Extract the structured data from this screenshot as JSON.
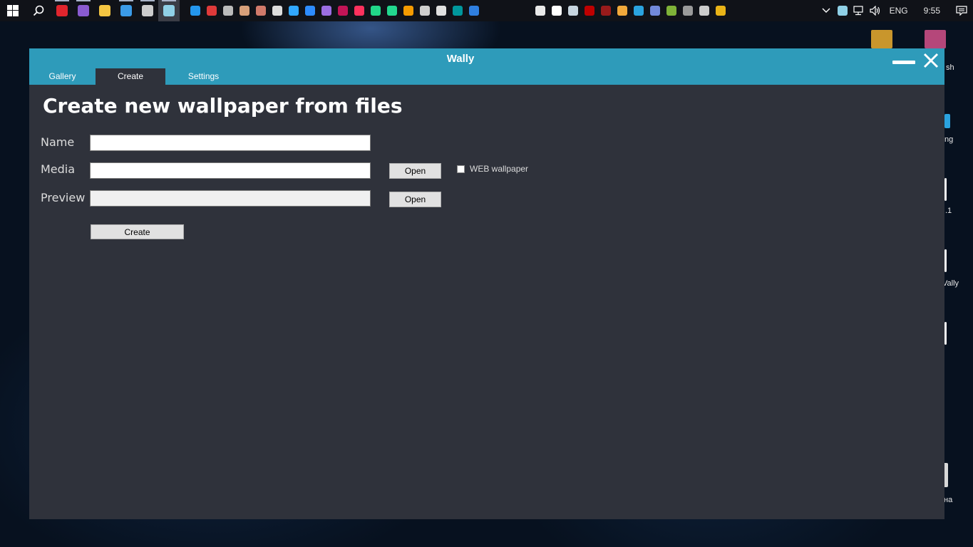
{
  "taskbar": {
    "start_icon": "windows-logo-icon",
    "search_icon": "search-icon",
    "pinned": [
      {
        "name": "opera-icon",
        "color": "#e1252d",
        "running": true
      },
      {
        "name": "visual-studio-icon",
        "color": "#8a5bd0",
        "running": true
      },
      {
        "name": "file-explorer-icon",
        "color": "#f4c542",
        "running": false
      },
      {
        "name": "internet-explorer-icon",
        "color": "#3b9be8",
        "running": true
      },
      {
        "name": "terminal-icon",
        "color": "#cccccc",
        "running": true
      },
      {
        "name": "wally-app-icon",
        "color": "#8fd0e6",
        "running": true,
        "active": true
      }
    ],
    "apps": [
      {
        "name": "docker-icon",
        "color": "#2496ed"
      },
      {
        "name": "git-icon",
        "color": "#e03a3a"
      },
      {
        "name": "clock-app-icon",
        "color": "#bbbbbb"
      },
      {
        "name": "app-icon-1",
        "color": "#d8a07a"
      },
      {
        "name": "app-icon-2",
        "color": "#d27a6a"
      },
      {
        "name": "copy-app-icon",
        "color": "#dddddd"
      },
      {
        "name": "photoshop-icon",
        "color": "#31a8ff"
      },
      {
        "name": "zoom-icon",
        "color": "#2d8cff"
      },
      {
        "name": "visual-studio-code-icon",
        "color": "#9b6ee3"
      },
      {
        "name": "rider-icon",
        "color": "#c21456"
      },
      {
        "name": "intellij-icon",
        "color": "#fe315d"
      },
      {
        "name": "pycharm-icon",
        "color": "#21d789"
      },
      {
        "name": "clion-icon",
        "color": "#22d88f"
      },
      {
        "name": "virtualbox-icon",
        "color": "#f59b00"
      },
      {
        "name": "image-viewer-icon",
        "color": "#cfcfcf"
      },
      {
        "name": "unity-icon",
        "color": "#e0e0e0"
      },
      {
        "name": "arduino-icon",
        "color": "#00979c"
      },
      {
        "name": "blue-app-icon",
        "color": "#2f7fe0"
      }
    ],
    "tray_apps": [
      {
        "name": "chrome-icon",
        "color": "#e9e9e9"
      },
      {
        "name": "wave-app-icon",
        "color": "#ffffff"
      },
      {
        "name": "steam-icon",
        "color": "#c7d5e0"
      },
      {
        "name": "filezilla-icon",
        "color": "#bf0000"
      },
      {
        "name": "vim-icon",
        "color": "#9a1b1b"
      },
      {
        "name": "chess-app-icon",
        "color": "#f2a93b"
      },
      {
        "name": "telegram-icon",
        "color": "#2aa3df"
      },
      {
        "name": "discord-icon",
        "color": "#7289da"
      },
      {
        "name": "minecraft-icon",
        "color": "#7fb238"
      },
      {
        "name": "app-icon-3",
        "color": "#9a9a9a"
      },
      {
        "name": "gear-app-icon",
        "color": "#cccccc"
      },
      {
        "name": "yellow-app-icon",
        "color": "#e9b317"
      }
    ],
    "tray": {
      "chevron_icon": "chevron-up-icon",
      "language": "ENG",
      "time": "9:55"
    }
  },
  "desktop_fragments": {
    "label_1": "sh",
    "label_2": "ng",
    "label_3": ".1",
    "label_4": "Vally",
    "label_5": "на"
  },
  "window": {
    "title": "Wally",
    "tabs": [
      {
        "label": "Gallery",
        "active": false
      },
      {
        "label": "Create",
        "active": true
      },
      {
        "label": "Settings",
        "active": false
      }
    ],
    "page_title": "Create new wallpaper from files",
    "fields": {
      "name_label": "Name",
      "name_value": "",
      "media_label": "Media",
      "media_value": "",
      "preview_label": "Preview",
      "preview_value": ""
    },
    "buttons": {
      "media_open": "Open",
      "preview_open": "Open",
      "create": "Create"
    },
    "web_wallpaper_label": "WEB wallpaper",
    "web_wallpaper_checked": false,
    "colors": {
      "titlebar": "#2e9bba",
      "background": "#2f323b",
      "text": "#ffffff"
    }
  }
}
